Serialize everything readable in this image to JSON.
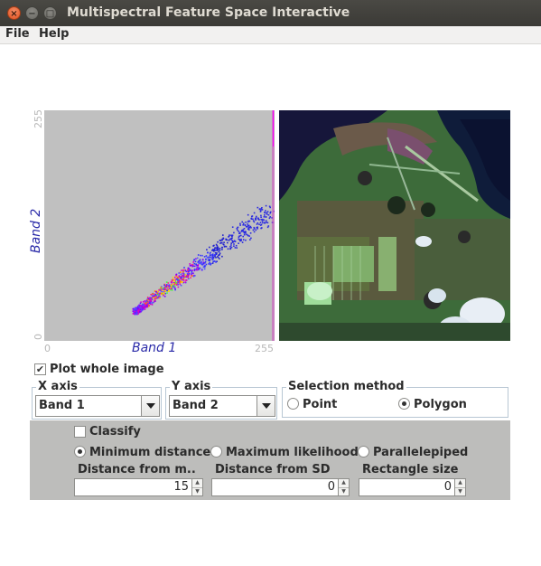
{
  "window": {
    "title": "Multispectral Feature Space Interactive"
  },
  "menu": {
    "file": "File",
    "help": "Help"
  },
  "plot": {
    "x_label": "Band 1",
    "y_label": "Band 2",
    "x_min": "0",
    "x_max": "255",
    "y_min": "0",
    "y_max": "255"
  },
  "controls": {
    "plot_whole_image": {
      "label": "Plot whole image",
      "checked": true
    },
    "x_axis": {
      "title": "X axis",
      "value": "Band 1"
    },
    "y_axis": {
      "title": "Y axis",
      "value": "Band 2"
    },
    "selection_method": {
      "title": "Selection method",
      "point": "Point",
      "polygon": "Polygon",
      "selected": "Polygon"
    },
    "classify": {
      "label": "Classify",
      "checked": false
    },
    "classifier": {
      "minimum_distance": "Minimum distance",
      "maximum_likelihood": "Maximum likelihood",
      "parallelepiped": "Parallelepiped",
      "selected": "Minimum distance"
    },
    "distance_from_mean": {
      "label": "Distance from m...",
      "value": "15"
    },
    "distance_from_sd": {
      "label": "Distance from SD",
      "value": "0"
    },
    "rectangle_size": {
      "label": "Rectangle size",
      "value": "0"
    }
  },
  "colors": {
    "plot_bg": "#c0c0c0",
    "axis_label": "#2a2aa8",
    "panel_bg": "#bdbdbb"
  },
  "icons": {
    "close": "close-icon",
    "minimize": "minimize-icon",
    "maximize": "maximize-icon"
  }
}
